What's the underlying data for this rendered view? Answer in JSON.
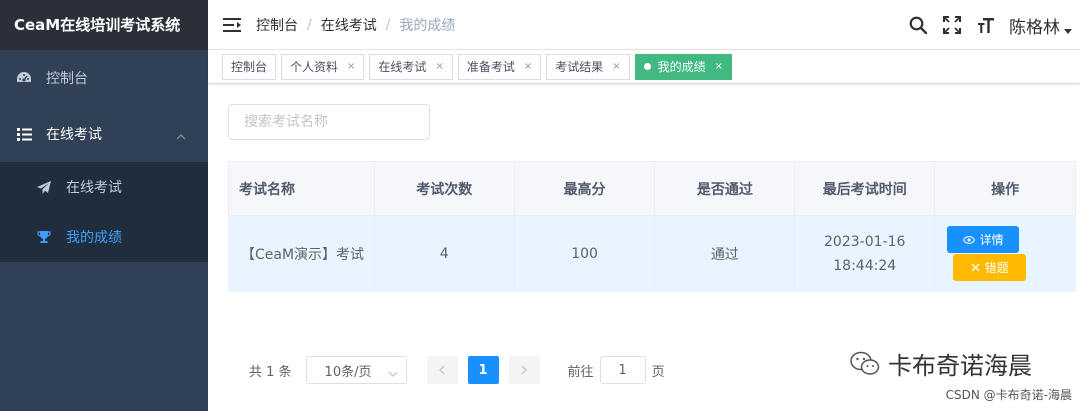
{
  "app": {
    "title": "CeaM在线培训考试系统"
  },
  "sidebar": {
    "items": [
      {
        "label": "控制台",
        "icon": "dashboard-icon"
      },
      {
        "label": "在线考试",
        "icon": "list-icon",
        "expanded": true,
        "children": [
          {
            "label": "在线考试",
            "icon": "paper-plane-icon",
            "active": false
          },
          {
            "label": "我的成绩",
            "icon": "trophy-icon",
            "active": true
          }
        ]
      }
    ]
  },
  "header": {
    "breadcrumb": [
      "控制台",
      "在线考试",
      "我的成绩"
    ],
    "username": "陈格林",
    "icons": [
      "search-icon",
      "fullscreen-icon",
      "font-size-icon"
    ]
  },
  "tags": [
    {
      "label": "控制台",
      "closable": false,
      "active": false
    },
    {
      "label": "个人资料",
      "closable": true,
      "active": false
    },
    {
      "label": "在线考试",
      "closable": true,
      "active": false
    },
    {
      "label": "准备考试",
      "closable": true,
      "active": false
    },
    {
      "label": "考试结果",
      "closable": true,
      "active": false
    },
    {
      "label": "我的成绩",
      "closable": true,
      "active": true
    }
  ],
  "tags_close_glyph": "×",
  "search": {
    "placeholder": "搜索考试名称",
    "value": ""
  },
  "table": {
    "columns": [
      "考试名称",
      "考试次数",
      "最高分",
      "是否通过",
      "最后考试时间",
      "操作"
    ],
    "rows": [
      {
        "name": "【CeaM演示】考试",
        "count": "4",
        "max_score": "100",
        "passed": "通过",
        "last_time": "2023-01-16 18:44:24"
      }
    ],
    "actions": {
      "detail": "详情",
      "wrong": "错题"
    }
  },
  "pagination": {
    "total_text": "共 1 条",
    "page_size": "10条/页",
    "current_page": "1",
    "goto_prefix": "前往",
    "goto_value": "1",
    "goto_suffix": "页"
  },
  "watermark": {
    "wechat": "卡布奇诺海晨",
    "csdn": "CSDN @卡布奇诺-海晨"
  },
  "colors": {
    "sidebar_bg": "#304156",
    "brand_bg": "#2b2f3a",
    "submenu_bg": "#1f2d3d",
    "active_blue": "#409eff",
    "tag_active": "#42b983",
    "primary": "#1890ff",
    "warning": "#ffba00",
    "success": "#67c23a"
  }
}
